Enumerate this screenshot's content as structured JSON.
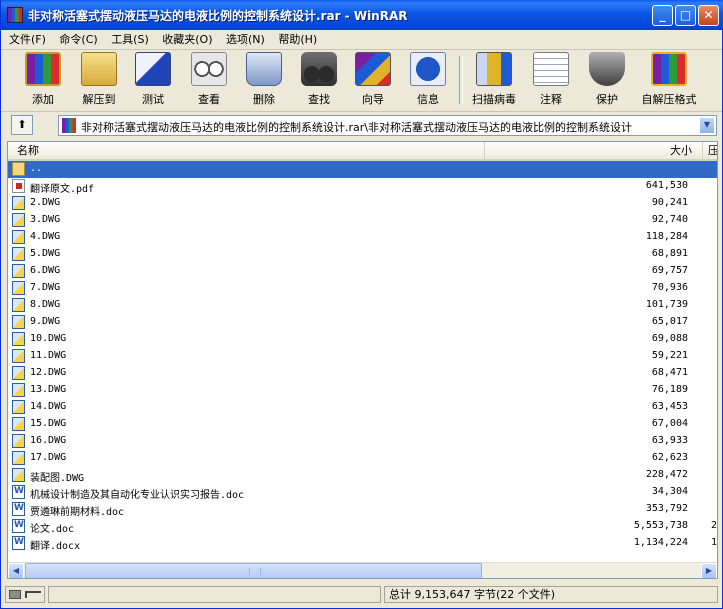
{
  "window": {
    "title": "非对称活塞式摆动液压马达的电液比例的控制系统设计.rar - WinRAR"
  },
  "menu": [
    "文件(F)",
    "命令(C)",
    "工具(S)",
    "收藏夹(O)",
    "选项(N)",
    "帮助(H)"
  ],
  "toolbar": [
    {
      "label": "添加",
      "icon": "add-archive-icon"
    },
    {
      "label": "解压到",
      "icon": "extract-to-icon"
    },
    {
      "label": "测试",
      "icon": "test-icon"
    },
    {
      "label": "查看",
      "icon": "view-icon"
    },
    {
      "label": "删除",
      "icon": "delete-icon"
    },
    {
      "label": "查找",
      "icon": "find-binoculars-icon"
    },
    {
      "label": "向导",
      "icon": "wizard-icon"
    },
    {
      "label": "信息",
      "icon": "info-icon"
    },
    {
      "label": "扫描病毒",
      "icon": "virus-scan-icon"
    },
    {
      "label": "注释",
      "icon": "comment-icon"
    },
    {
      "label": "保护",
      "icon": "protect-shield-icon"
    },
    {
      "label": "自解压格式",
      "icon": "sfx-icon"
    }
  ],
  "address": {
    "path": "非对称活塞式摆动液压马达的电液比例的控制系统设计.rar\\非对称活塞式摆动液压马达的电液比例的控制系统设计"
  },
  "columns": {
    "name": "名称",
    "size": "大小",
    "packed": "压"
  },
  "files": [
    {
      "name": "..",
      "size": "",
      "type": "folder",
      "cut": ""
    },
    {
      "name": "翻译原文.pdf",
      "size": "641,530",
      "type": "pdf",
      "cut": ""
    },
    {
      "name": "2.DWG",
      "size": "90,241",
      "type": "dwg",
      "cut": ""
    },
    {
      "name": "3.DWG",
      "size": "92,740",
      "type": "dwg",
      "cut": ""
    },
    {
      "name": "4.DWG",
      "size": "118,284",
      "type": "dwg",
      "cut": ""
    },
    {
      "name": "5.DWG",
      "size": "68,891",
      "type": "dwg",
      "cut": ""
    },
    {
      "name": "6.DWG",
      "size": "69,757",
      "type": "dwg",
      "cut": ""
    },
    {
      "name": "7.DWG",
      "size": "70,936",
      "type": "dwg",
      "cut": ""
    },
    {
      "name": "8.DWG",
      "size": "101,739",
      "type": "dwg",
      "cut": ""
    },
    {
      "name": "9.DWG",
      "size": "65,017",
      "type": "dwg",
      "cut": ""
    },
    {
      "name": "10.DWG",
      "size": "69,088",
      "type": "dwg",
      "cut": ""
    },
    {
      "name": "11.DWG",
      "size": "59,221",
      "type": "dwg",
      "cut": ""
    },
    {
      "name": "12.DWG",
      "size": "68,471",
      "type": "dwg",
      "cut": ""
    },
    {
      "name": "13.DWG",
      "size": "76,189",
      "type": "dwg",
      "cut": ""
    },
    {
      "name": "14.DWG",
      "size": "63,453",
      "type": "dwg",
      "cut": ""
    },
    {
      "name": "15.DWG",
      "size": "67,004",
      "type": "dwg",
      "cut": ""
    },
    {
      "name": "16.DWG",
      "size": "63,933",
      "type": "dwg",
      "cut": ""
    },
    {
      "name": "17.DWG",
      "size": "62,623",
      "type": "dwg",
      "cut": ""
    },
    {
      "name": "装配图.DWG",
      "size": "228,472",
      "type": "dwg",
      "cut": ""
    },
    {
      "name": "机械设计制造及其自动化专业认识实习报告.doc",
      "size": "34,304",
      "type": "doc",
      "cut": ""
    },
    {
      "name": "贾遴琳前期材料.doc",
      "size": "353,792",
      "type": "doc",
      "cut": ""
    },
    {
      "name": "论文.doc",
      "size": "5,553,738",
      "type": "doc",
      "cut": "2"
    },
    {
      "name": "翻译.docx",
      "size": "1,134,224",
      "type": "doc",
      "cut": "1"
    }
  ],
  "status": {
    "summary": "总计 9,153,647 字节(22 个文件)"
  },
  "colors": {
    "selection": "#316ac5",
    "titlebar": "#0a56e6",
    "chrome": "#ece9d8"
  }
}
